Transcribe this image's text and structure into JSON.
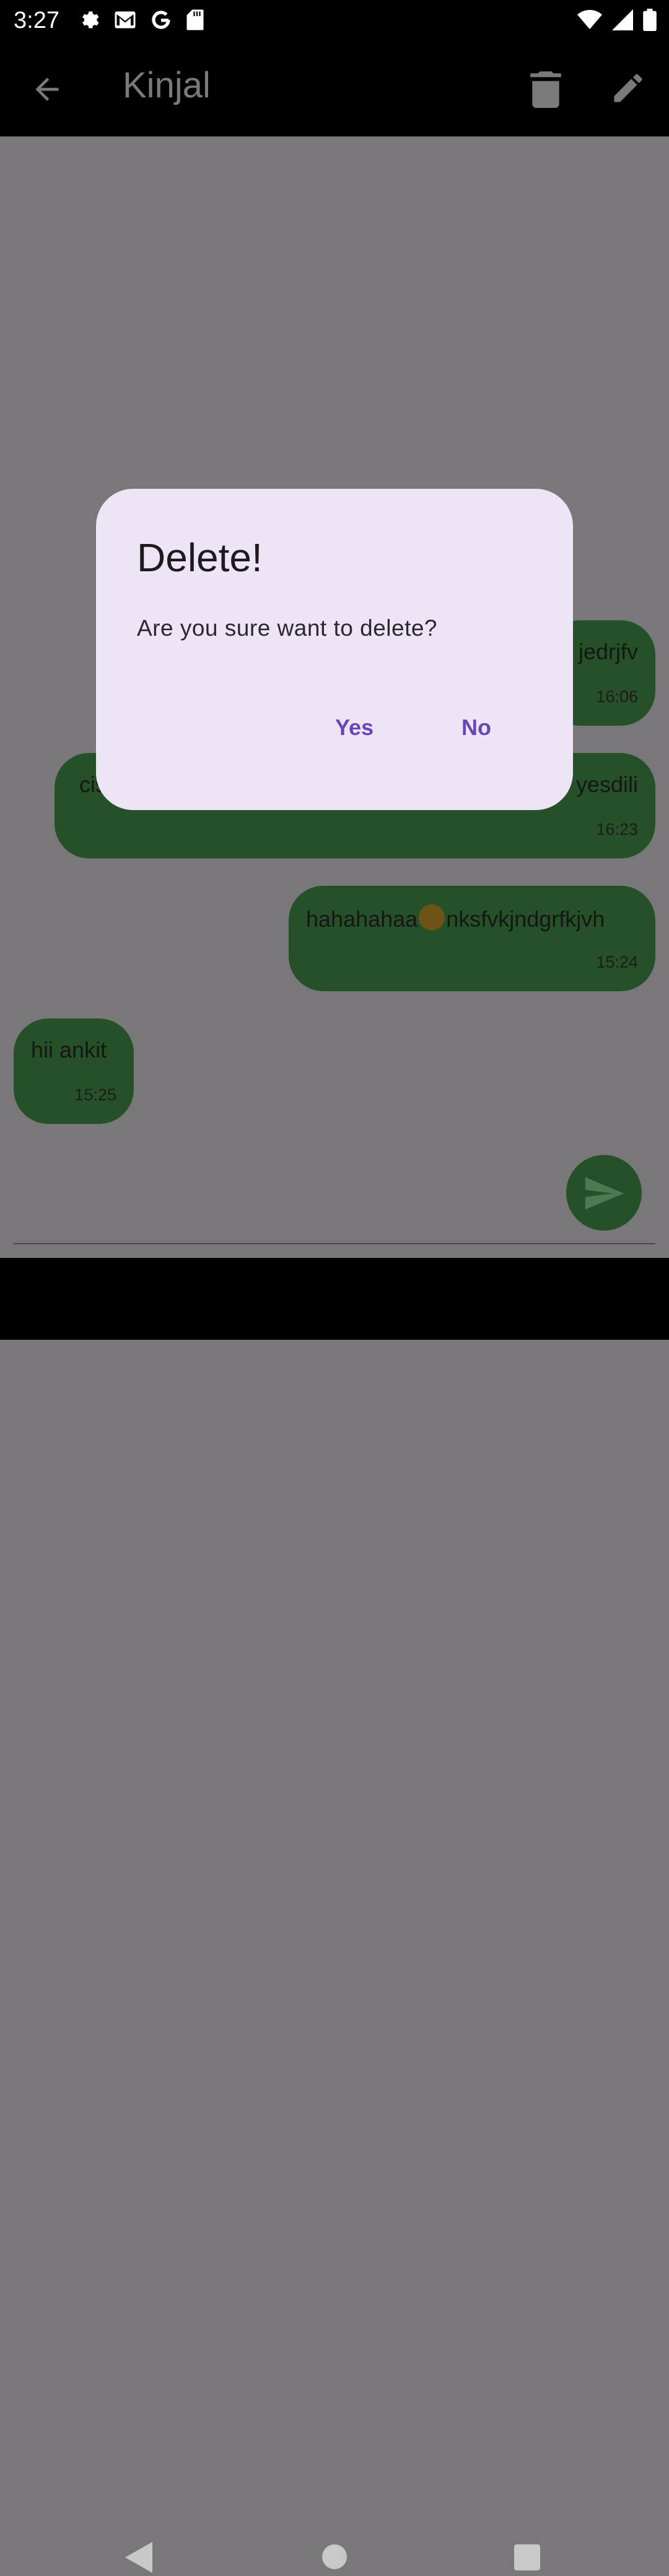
{
  "status_bar": {
    "time": "3:27",
    "icons_left": [
      "gear-icon",
      "gmail-icon",
      "google-icon",
      "sd-card-icon"
    ],
    "icons_right": [
      "wifi-icon",
      "signal-icon",
      "battery-icon"
    ]
  },
  "app_bar": {
    "title": "Kinjal",
    "back_icon": "arrow-back-icon",
    "actions": [
      "delete-icon",
      "edit-icon"
    ]
  },
  "messages": [
    {
      "text": "jedrjfv",
      "time": "16:06"
    },
    {
      "text_left": "cis",
      "text": "yesdili",
      "time": "16:23"
    },
    {
      "text_before_emoji": "hahahahaa",
      "emoji": "wink-emoji",
      "text_after_emoji": "nksfvkjndgrfkjvh",
      "time": "15:24"
    },
    {
      "text": "hii ankit",
      "time": "15:25"
    }
  ],
  "dialog": {
    "title": "Delete!",
    "message": "Are you sure want to delete?",
    "yes_label": "Yes",
    "no_label": "No"
  },
  "colors": {
    "scrim": "#7a777b",
    "bubble": "#265128",
    "dialog_bg": "#ede4f6",
    "dialog_button": "#6a45b8"
  }
}
